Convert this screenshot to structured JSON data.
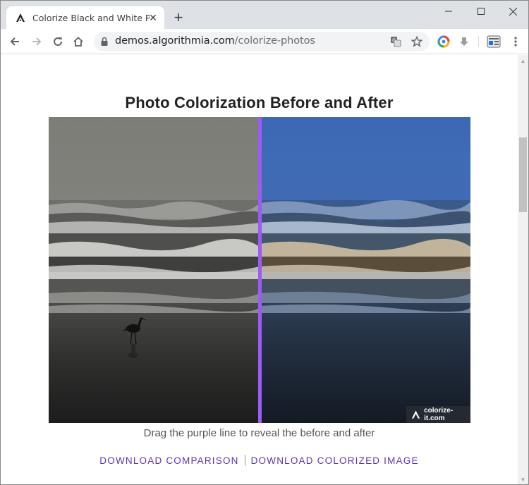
{
  "browser": {
    "tab_title": "Colorize Black and White Photos",
    "new_tab_symbol": "+",
    "url_host": "demos.algorithmia.com",
    "url_path": "/colorize-photos"
  },
  "page": {
    "title": "Photo Colorization Before and After",
    "caption": "Drag the purple line to reveal the before and after",
    "watermark": "colorize-it.com",
    "links": {
      "comparison": "DOWNLOAD COMPARISON",
      "colorized": "DOWNLOAD COLORIZED IMAGE"
    },
    "divider_position": 0.5
  },
  "colors": {
    "accent": "#9a5cf5",
    "link": "#5b36b8",
    "tabstrip": "#dee1e6"
  },
  "icons": [
    "algorithmia-logo-icon",
    "close-icon",
    "minimize-icon",
    "maximize-icon",
    "back-icon",
    "forward-icon",
    "reload-icon",
    "home-icon",
    "lock-icon",
    "translate-icon",
    "star-icon",
    "extension-icon",
    "download-icon",
    "profile-icon",
    "menu-icon"
  ]
}
